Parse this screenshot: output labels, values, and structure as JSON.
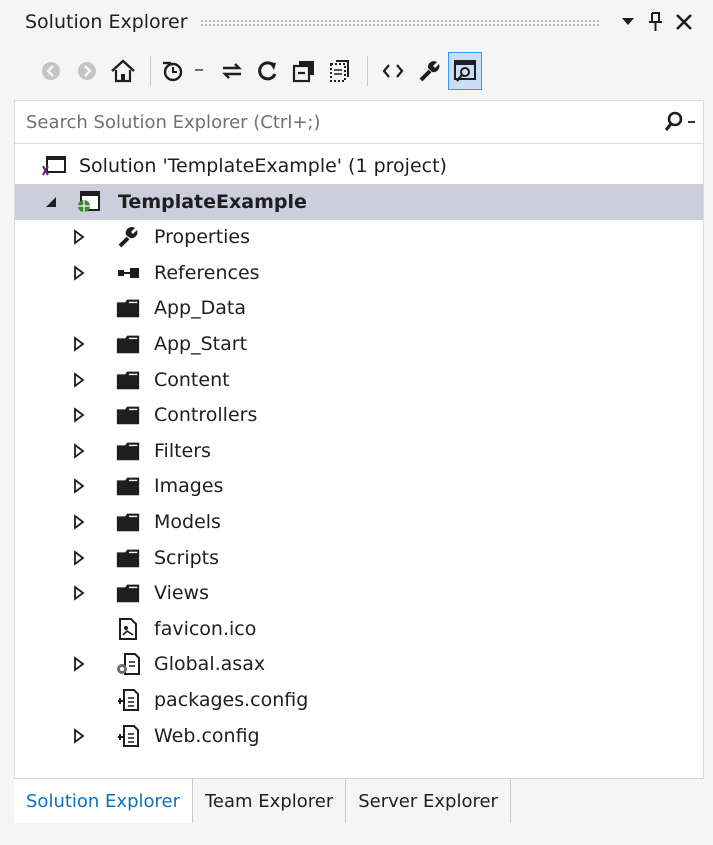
{
  "window": {
    "title": "Solution Explorer"
  },
  "title_buttons": {
    "dropdown_glyph": "▼",
    "pin_glyph": "ᛘ",
    "close_glyph": "✕"
  },
  "toolbar": {
    "buttons": [
      "back-icon",
      "forward-icon",
      "home-icon",
      "pending-changes-icon",
      "sync-icon",
      "refresh-icon",
      "collapse-all-icon",
      "show-all-files-icon",
      "view-code-icon",
      "properties-icon",
      "preview-selected-icon"
    ],
    "active_button": "preview-selected-icon",
    "accent": "#3399ff"
  },
  "search": {
    "placeholder": "Search Solution Explorer (Ctrl+;)",
    "value": ""
  },
  "tree": {
    "items": [
      {
        "label": "Solution 'TemplateExample' (1 project)",
        "icon": "solution-icon",
        "expander": "none",
        "level": "solution"
      },
      {
        "label": "TemplateExample",
        "icon": "web-project-icon",
        "expander": "expanded",
        "level": "project",
        "selected": true
      },
      {
        "label": "Properties",
        "icon": "wrench-icon",
        "expander": "collapsed"
      },
      {
        "label": "References",
        "icon": "references-icon",
        "expander": "collapsed"
      },
      {
        "label": "App_Data",
        "icon": "folder-icon",
        "expander": "none"
      },
      {
        "label": "App_Start",
        "icon": "folder-icon",
        "expander": "collapsed"
      },
      {
        "label": "Content",
        "icon": "folder-icon",
        "expander": "collapsed"
      },
      {
        "label": "Controllers",
        "icon": "folder-icon",
        "expander": "collapsed"
      },
      {
        "label": "Filters",
        "icon": "folder-icon",
        "expander": "collapsed"
      },
      {
        "label": "Images",
        "icon": "folder-icon",
        "expander": "collapsed"
      },
      {
        "label": "Models",
        "icon": "folder-icon",
        "expander": "collapsed"
      },
      {
        "label": "Scripts",
        "icon": "folder-icon",
        "expander": "collapsed"
      },
      {
        "label": "Views",
        "icon": "folder-icon",
        "expander": "collapsed"
      },
      {
        "label": "favicon.ico",
        "icon": "image-file-icon",
        "expander": "none"
      },
      {
        "label": "Global.asax",
        "icon": "global-asax-icon",
        "expander": "collapsed"
      },
      {
        "label": "packages.config",
        "icon": "config-file-icon",
        "expander": "none"
      },
      {
        "label": "Web.config",
        "icon": "config-file-icon",
        "expander": "collapsed"
      }
    ],
    "selected_color": "#cccedb"
  },
  "tabs": [
    {
      "label": "Solution Explorer",
      "active": true
    },
    {
      "label": "Team Explorer",
      "active": false
    },
    {
      "label": "Server Explorer",
      "active": false
    }
  ],
  "colors": {
    "active_tab": "#0e70c0",
    "background": "#f5f5f5"
  }
}
